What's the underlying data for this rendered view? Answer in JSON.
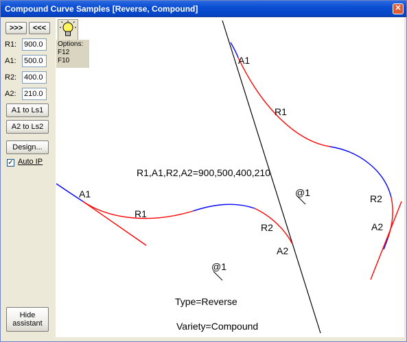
{
  "window": {
    "title": "Compound Curve Samples [Reverse, Compound]",
    "close_glyph": "✕"
  },
  "toolbar": {
    "next_label": ">>>",
    "prev_label": "<<<"
  },
  "params": [
    {
      "label": "R1:",
      "value": "900.0"
    },
    {
      "label": "A1:",
      "value": "500.0"
    },
    {
      "label": "R2:",
      "value": "400.0"
    },
    {
      "label": "A2:",
      "value": "210.0"
    }
  ],
  "buttons": {
    "a1_to_ls1": "A1 to Ls1",
    "a2_to_ls2": "A2 to Ls2",
    "design": "Design...",
    "hide_assistant_line1": "Hide",
    "hide_assistant_line2": "assistant"
  },
  "auto_ip": {
    "label": "Auto IP",
    "checked": true,
    "check_glyph": "✓"
  },
  "options": {
    "title": "Options:",
    "items": [
      "F12",
      "F10"
    ],
    "icon": "lightbulb-icon"
  },
  "canvas": {
    "summary": "R1,A1,R2,A2=900,500,400,210",
    "type_text": "Type=Reverse",
    "variety_text": "Variety=Compound",
    "labels": {
      "a1_top": "A1",
      "r1_top": "R1",
      "r2_right": "R2",
      "a2_right": "A2",
      "at1_right": "@1",
      "a1_left": "A1",
      "r1_left": "R1",
      "r2_left": "R2",
      "a2_left": "A2",
      "at1_left": "@1"
    },
    "colors": {
      "arc": "#FF0000",
      "clothoid": "#0000FF",
      "line": "#000000"
    }
  }
}
